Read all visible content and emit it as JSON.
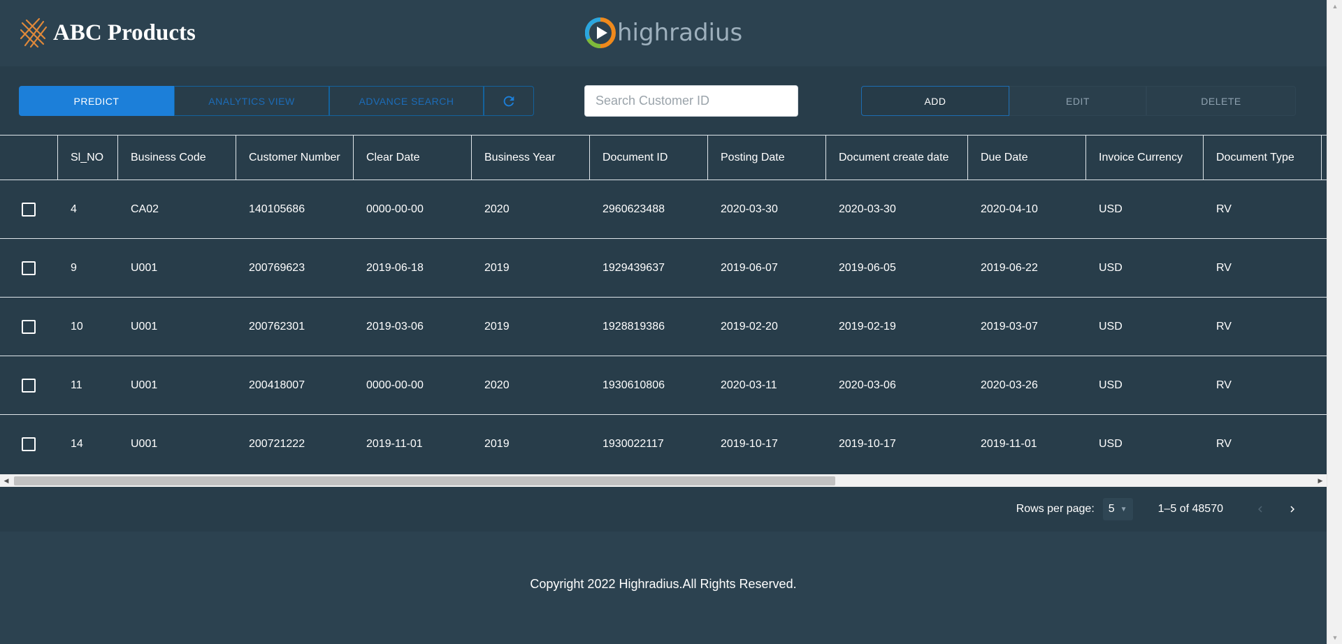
{
  "header": {
    "brand_name": "ABC Products",
    "partner_logo_text": "highradius"
  },
  "toolbar": {
    "predict_label": "PREDICT",
    "analytics_label": "ANALYTICS VIEW",
    "advance_search_label": "ADVANCE SEARCH",
    "search_placeholder": "Search Customer ID",
    "add_label": "ADD",
    "edit_label": "EDIT",
    "delete_label": "DELETE"
  },
  "table": {
    "columns": [
      "Sl_NO",
      "Business Code",
      "Customer Number",
      "Clear Date",
      "Business Year",
      "Document ID",
      "Posting Date",
      "Document create date",
      "Due Date",
      "Invoice Currency",
      "Document Type"
    ],
    "rows": [
      [
        "4",
        "CA02",
        "140105686",
        "0000-00-00",
        "2020",
        "2960623488",
        "2020-03-30",
        "2020-03-30",
        "2020-04-10",
        "USD",
        "RV"
      ],
      [
        "9",
        "U001",
        "200769623",
        "2019-06-18",
        "2019",
        "1929439637",
        "2019-06-07",
        "2019-06-05",
        "2019-06-22",
        "USD",
        "RV"
      ],
      [
        "10",
        "U001",
        "200762301",
        "2019-03-06",
        "2019",
        "1928819386",
        "2019-02-20",
        "2019-02-19",
        "2019-03-07",
        "USD",
        "RV"
      ],
      [
        "11",
        "U001",
        "200418007",
        "0000-00-00",
        "2020",
        "1930610806",
        "2020-03-11",
        "2020-03-06",
        "2020-03-26",
        "USD",
        "RV"
      ],
      [
        "14",
        "U001",
        "200721222",
        "2019-11-01",
        "2019",
        "1930022117",
        "2019-10-17",
        "2019-10-17",
        "2019-11-01",
        "USD",
        "RV"
      ]
    ]
  },
  "pagination": {
    "rows_per_page_label": "Rows per page:",
    "rows_per_page_value": "5",
    "range_text": "1–5 of 48570"
  },
  "footer": {
    "copyright": "Copyright 2022 Highradius.All Rights Reserved."
  },
  "colors": {
    "accent": "#1c7fd9",
    "header_bg": "#2c4250",
    "table_bg": "#283d4a"
  }
}
